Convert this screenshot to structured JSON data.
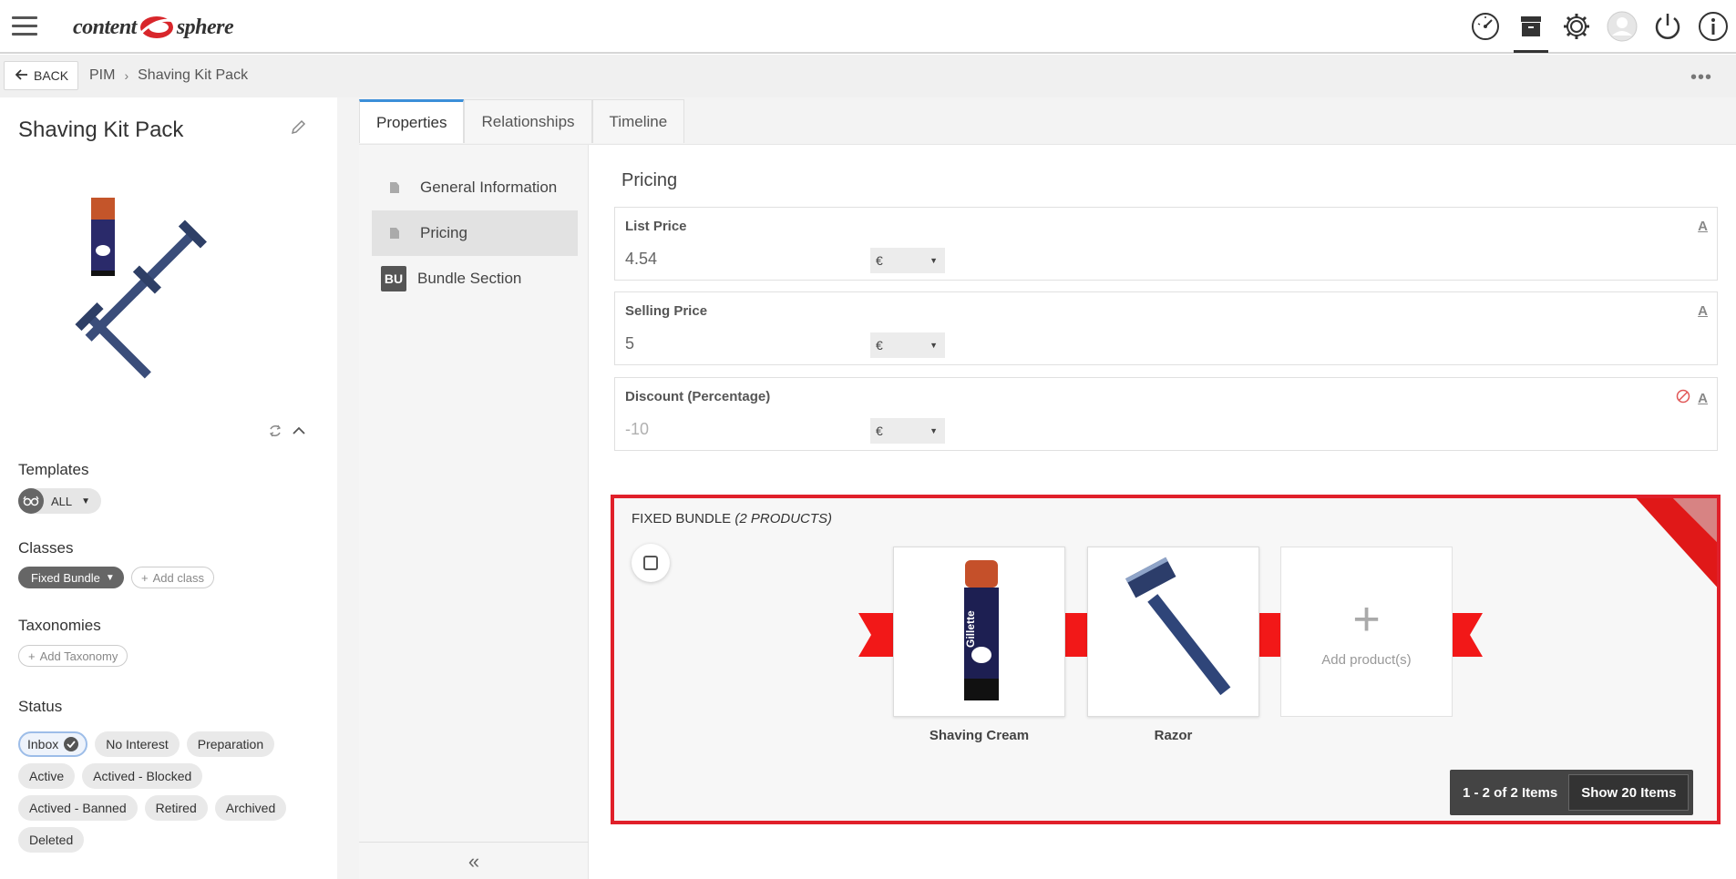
{
  "app": {
    "logo_left": "content",
    "logo_right": "sphere",
    "top_icons": [
      "dashboard-icon",
      "archive-icon",
      "settings-icon",
      "user-icon",
      "power-icon",
      "info-icon"
    ]
  },
  "breadcrumb": {
    "back_label": "BACK",
    "items": [
      "PIM",
      "Shaving Kit Pack"
    ],
    "separator": "›",
    "more": "•••"
  },
  "sidebar": {
    "title": "Shaving Kit Pack",
    "templates_label": "Templates",
    "template_value": "ALL",
    "classes_label": "Classes",
    "class_value": "Fixed Bundle",
    "add_class": "Add class",
    "taxonomies_label": "Taxonomies",
    "add_taxonomy": "Add Taxonomy",
    "status_label": "Status",
    "statuses": [
      [
        "Inbox",
        "No Interest",
        "Preparation"
      ],
      [
        "Active",
        "Actived - Blocked"
      ],
      [
        "Actived - Banned",
        "Retired",
        "Archived"
      ],
      [
        "Deleted"
      ]
    ],
    "selected_status": "Inbox"
  },
  "tabs": [
    "Properties",
    "Relationships",
    "Timeline"
  ],
  "active_tab": "Properties",
  "nav": {
    "items": [
      "General Information",
      "Pricing",
      "Bundle Section"
    ],
    "bundle_badge": "BU",
    "active": "Pricing",
    "collapse": "«"
  },
  "pricing": {
    "title": "Pricing",
    "fields": [
      {
        "label": "List Price",
        "value": "4.54",
        "currency": "€"
      },
      {
        "label": "Selling Price",
        "value": "5",
        "currency": "€"
      },
      {
        "label": "Discount (Percentage)",
        "value": "-10",
        "currency": "€"
      }
    ],
    "attr_icon": "A"
  },
  "bundle": {
    "title": "FIXED BUNDLE",
    "count": "(2 PRODUCTS)",
    "products": [
      "Shaving Cream",
      "Razor"
    ],
    "add_label": "Add product(s)",
    "plus": "+",
    "pager_text": "1 - 2 of 2 Items",
    "show_label": "Show 20 Items",
    "ribbon_color": "#f21818",
    "border_color": "#e0202a"
  },
  "colors": {
    "accent": "#3b8fd9",
    "logo_red": "#d8262b"
  }
}
